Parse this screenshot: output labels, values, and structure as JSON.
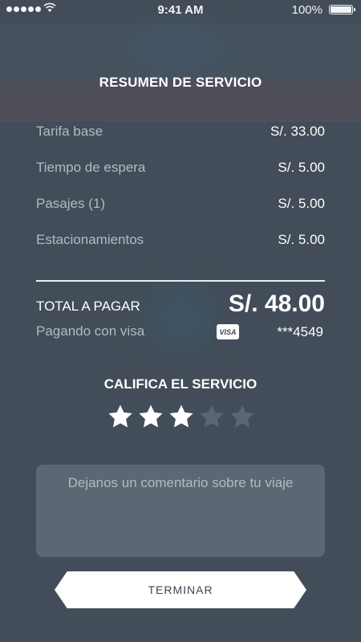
{
  "status_bar": {
    "time": "9:41 AM",
    "battery": "100%"
  },
  "summary": {
    "title": "RESUMEN DE SERVICIO",
    "rows": [
      {
        "label": "Tarifa base",
        "value": "S/. 33.00"
      },
      {
        "label": "Tiempo de espera",
        "value": "S/. 5.00"
      },
      {
        "label": "Pasajes (1)",
        "value": "S/. 5.00"
      },
      {
        "label": "Estacionamientos",
        "value": "S/. 5.00"
      }
    ],
    "total_label": "TOTAL A PAGAR",
    "total_value": "S/. 48.00",
    "paying_label": "Pagando con visa",
    "card_brand": "VISA",
    "card_number": "***4549"
  },
  "rating": {
    "title": "CALIFICA EL SERVICIO",
    "value": 3,
    "max": 5
  },
  "comment": {
    "placeholder": "Dejanos un comentario sobre tu viaje",
    "value": ""
  },
  "actions": {
    "finish_label": "TERMINAR"
  },
  "colors": {
    "overlay": "#3e4854",
    "label_gray": "#b1bac4",
    "star_filled": "#ffffff",
    "star_empty": "#5c6672",
    "button_bg": "#ffffff"
  },
  "icons": [
    "signal-dots-icon",
    "wifi-icon",
    "battery-icon",
    "visa-card-icon",
    "star-icon"
  ]
}
